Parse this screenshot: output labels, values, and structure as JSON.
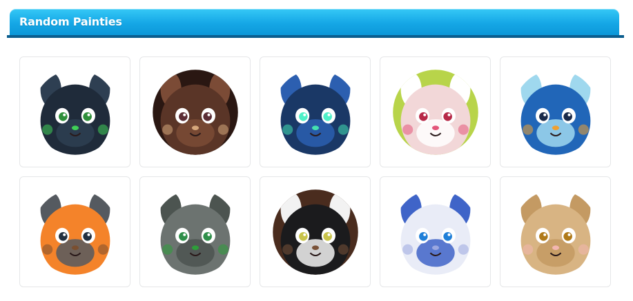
{
  "header": {
    "title": "Random Painties"
  },
  "painties": [
    {
      "icon": "dark-dragon-icon",
      "bg": "#ffffff",
      "c1": "#1f2b3a",
      "c2": "#2e3f52",
      "accent": "#3fcf57",
      "eye": "#2e8f3a"
    },
    {
      "icon": "brown-bunny-icon",
      "bg": "#2a1712",
      "c1": "#5a3527",
      "c2": "#7b4b36",
      "accent": "#d6a77b",
      "eye": "#5b2d35"
    },
    {
      "icon": "blue-wolf-icon",
      "bg": "#ffffff",
      "c1": "#1a3866",
      "c2": "#2c5fb0",
      "accent": "#44e0b0",
      "eye": "#4ef0c8"
    },
    {
      "icon": "flower-crown-bunny-icon",
      "bg": "#b8d44a",
      "c1": "#f2d7d8",
      "c2": "#ffffff",
      "accent": "#e3567a",
      "eye": "#b72948"
    },
    {
      "icon": "blue-bird-icon",
      "bg": "#ffffff",
      "c1": "#2166b8",
      "c2": "#9fd8ee",
      "accent": "#f0a030",
      "eye": "#1a2a4a"
    },
    {
      "icon": "pirate-orange-critter-icon",
      "bg": "#ffffff",
      "c1": "#f4832a",
      "c2": "#555a60",
      "accent": "#7a4f30",
      "eye": "#223040"
    },
    {
      "icon": "gray-mouse-icon",
      "bg": "#ffffff",
      "c1": "#6c7370",
      "c2": "#4c5450",
      "accent": "#2e9e3a",
      "eye": "#2f8f4a"
    },
    {
      "icon": "tuxedo-cat-icon",
      "bg": "#4a2c1e",
      "c1": "#1b1b1d",
      "c2": "#f2f2f2",
      "accent": "#7a5238",
      "eye": "#c8c34a"
    },
    {
      "icon": "white-fox-icon",
      "bg": "#ffffff",
      "c1": "#e9ecf7",
      "c2": "#3f64c8",
      "accent": "#9aa7e0",
      "eye": "#1f7fd8"
    },
    {
      "icon": "tan-bunny-icon",
      "bg": "#ffffff",
      "c1": "#d8b483",
      "c2": "#c49a63",
      "accent": "#f2b6b0",
      "eye": "#b07a1a"
    }
  ]
}
